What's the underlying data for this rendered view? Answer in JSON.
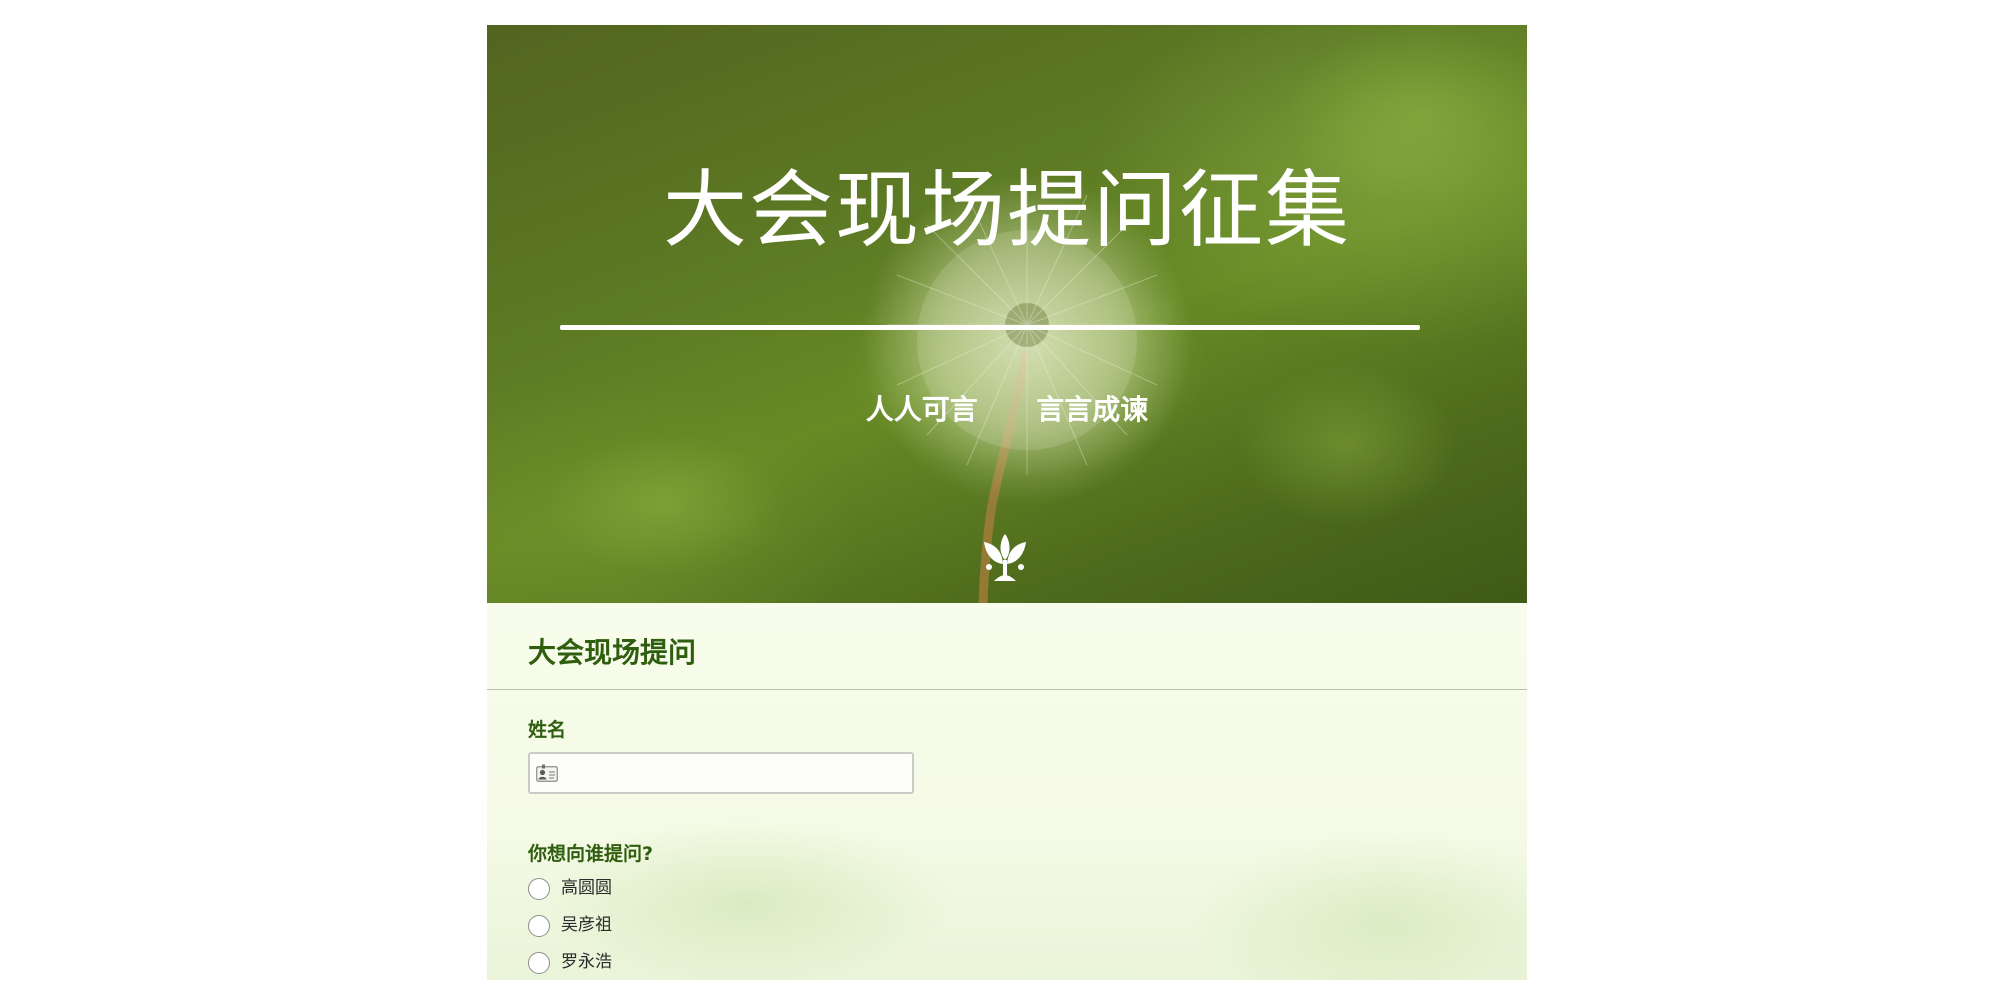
{
  "banner": {
    "title": "大会现场提问征集",
    "slogan": "人人可言      言言成谏",
    "logo_icon": "seedling-logo-icon"
  },
  "form": {
    "title": "大会现场提问",
    "name_field": {
      "label": "姓名",
      "value": "",
      "placeholder": "",
      "icon": "id-card-icon"
    },
    "question_target": {
      "label": "你想向谁提问?",
      "options": [
        "高圆圆",
        "吴彦祖",
        "罗永浩"
      ],
      "selected": null
    }
  },
  "colors": {
    "accent_green": "#2f5e0e",
    "banner_green": "#5d7a24",
    "form_background": "#f7fbe9"
  }
}
